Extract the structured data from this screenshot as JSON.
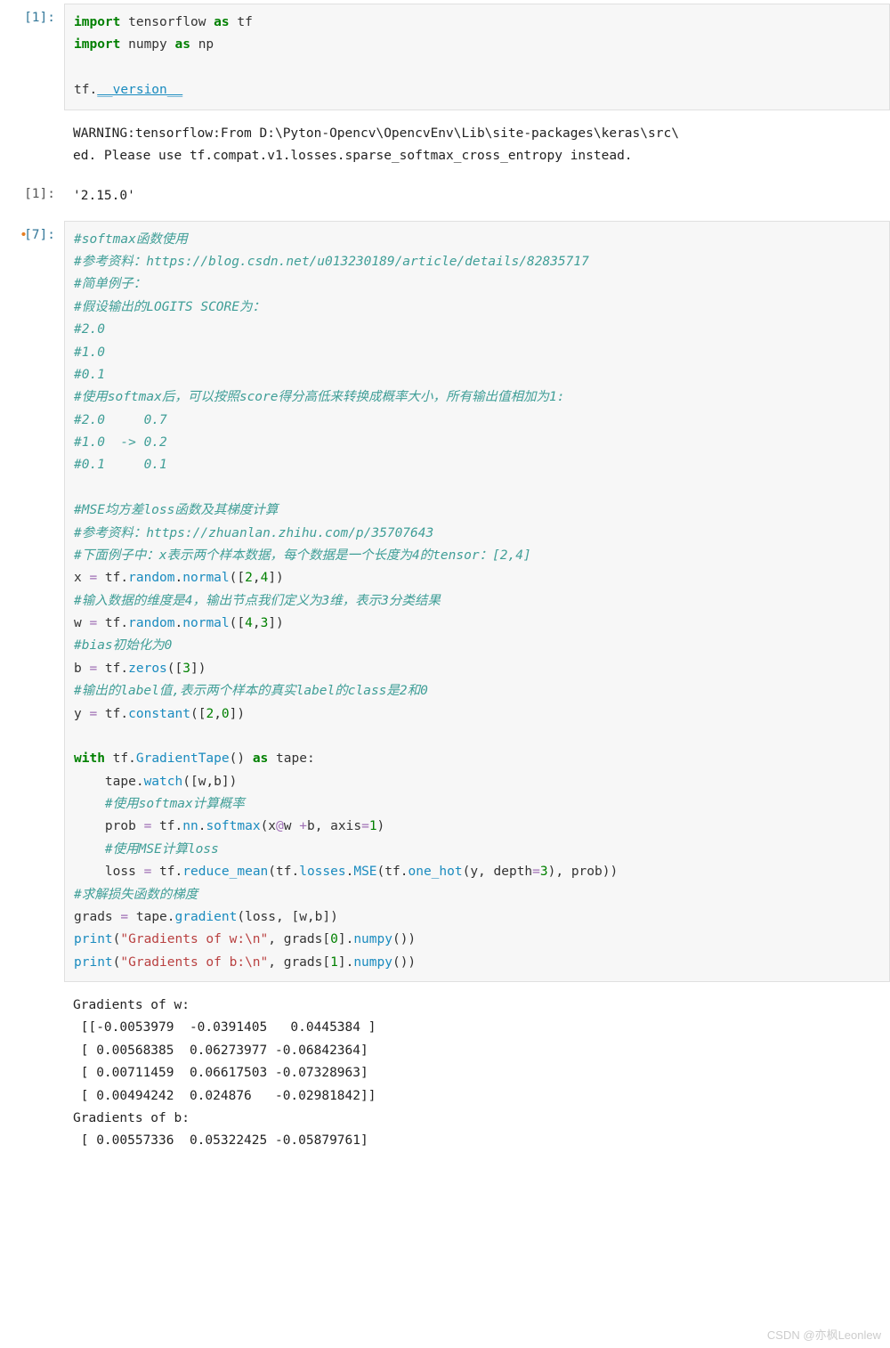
{
  "cells": {
    "c1": {
      "prompt": "[1]:",
      "code": {
        "kw_import1": "import",
        "mod_tf": " tensorflow ",
        "kw_as1": "as",
        "alias_tf": " tf",
        "kw_import2": "import",
        "mod_np": " numpy ",
        "kw_as2": "as",
        "alias_np": " np",
        "expr_tf": "tf",
        "dot": ".",
        "attr_version": "__version__"
      }
    },
    "out_warn": "WARNING:tensorflow:From D:\\Pyton-Opencv\\OpencvEnv\\Lib\\site-packages\\keras\\src\\\ned. Please use tf.compat.v1.losses.sparse_softmax_cross_entropy instead.",
    "c1_out": {
      "prompt": "[1]:",
      "text": "'2.15.0'"
    },
    "c7": {
      "prompt": "[7]:",
      "modified": "•",
      "code": {
        "cm01": "#softmax函数使用",
        "cm02": "#参考资料：https://blog.csdn.net/u013230189/article/details/82835717",
        "cm03": "#简单例子：",
        "cm04": "#假设输出的LOGITS SCORE为：",
        "cm05": "#2.0",
        "cm06": "#1.0",
        "cm07": "#0.1",
        "cm08": "#使用softmax后，可以按照score得分高低来转换成概率大小，所有输出值相加为1:",
        "cm09": "#2.0     0.7",
        "cm10": "#1.0  -> 0.2",
        "cm11": "#0.1     0.1",
        "cm_blank1": "",
        "cm20": "#MSE均方差loss函数及其梯度计算",
        "cm21": "#参考资料：https://zhuanlan.zhihu.com/p/35707643",
        "cm22": "#下面例子中：x表示两个样本数据，每个数据是一个长度为4的tensor：[2,4]",
        "ln_x": {
          "var": "x ",
          "eq": "=",
          "sp": " tf",
          "d1": ".",
          "a1": "random",
          "d2": ".",
          "fn": "normal",
          "op": "([",
          "n1": "2",
          "c": ",",
          "n2": "4",
          "cl": "])"
        },
        "cm23": "#输入数据的维度是4，输出节点我们定义为3维，表示3分类结果",
        "ln_w": {
          "var": "w ",
          "eq": "=",
          "sp": " tf",
          "d1": ".",
          "a1": "random",
          "d2": ".",
          "fn": "normal",
          "op": "([",
          "n1": "4",
          "c": ",",
          "n2": "3",
          "cl": "])"
        },
        "cm24": "#bias初始化为0",
        "ln_b": {
          "var": "b ",
          "eq": "=",
          "sp": " tf",
          "d1": ".",
          "fn": "zeros",
          "op": "([",
          "n1": "3",
          "cl": "])"
        },
        "cm25": "#输出的label值,表示两个样本的真实label的class是2和0",
        "ln_y": {
          "var": "y ",
          "eq": "=",
          "sp": " tf",
          "d1": ".",
          "fn": "constant",
          "op": "([",
          "n1": "2",
          "c": ",",
          "n2": "0",
          "cl": "])"
        },
        "cm_blank2": "",
        "with_kw": "with",
        "with_tf": " tf",
        "with_d": ".",
        "with_cls": "GradientTape",
        "with_p": "() ",
        "with_as": "as",
        "with_var": " tape:",
        "ind_watch": "    tape",
        "d_watch": ".",
        "fn_watch": "watch",
        "arg_watch": "([w,b])",
        "cm30": "    #使用softmax计算概率",
        "ln_prob": {
          "pre": "    prob ",
          "eq": "=",
          "tf": " tf",
          "d1": ".",
          "a1": "nn",
          "d2": ".",
          "fn": "softmax",
          "arg": "(x",
          "at": "@",
          "arg2": "w ",
          "plus": "+",
          "arg3": "b, axis",
          "eq2": "=",
          "n": "1",
          "cl": ")"
        },
        "cm31": "    #使用MSE计算loss",
        "ln_loss": {
          "pre": "    loss ",
          "eq": "=",
          "tf": " tf",
          "d1": ".",
          "fn1": "reduce_mean",
          "p1": "(tf",
          "d2": ".",
          "a2": "losses",
          "d3": ".",
          "fn2": "MSE",
          "p2": "(tf",
          "d4": ".",
          "fn3": "one_hot",
          "arg": "(y, depth",
          "eq2": "=",
          "n": "3",
          "cl": "), prob))"
        },
        "cm40": "#求解损失函数的梯度",
        "ln_grads": {
          "var": "grads ",
          "eq": "=",
          "sp": " tape",
          "d": ".",
          "fn": "gradient",
          "arg": "(loss, [w,b])"
        },
        "ln_p1": {
          "fn": "print",
          "p": "(",
          "s": "\"Gradients of w:\\n\"",
          "c": ", grads[",
          "n": "0",
          "c2": "]",
          "d": ".",
          "fnm": "numpy",
          "cl": "())"
        },
        "ln_p2": {
          "fn": "print",
          "p": "(",
          "s": "\"Gradients of b:\\n\"",
          "c": ", grads[",
          "n": "1",
          "c2": "]",
          "d": ".",
          "fnm": "numpy",
          "cl": "())"
        }
      }
    },
    "c7_out": "Gradients of w:\n [[-0.0053979  -0.0391405   0.0445384 ]\n [ 0.00568385  0.06273977 -0.06842364]\n [ 0.00711459  0.06617503 -0.07328963]\n [ 0.00494242  0.024876   -0.02981842]]\nGradients of b:\n [ 0.00557336  0.05322425 -0.05879761]"
  },
  "watermark": "CSDN @亦枫Leonlew"
}
